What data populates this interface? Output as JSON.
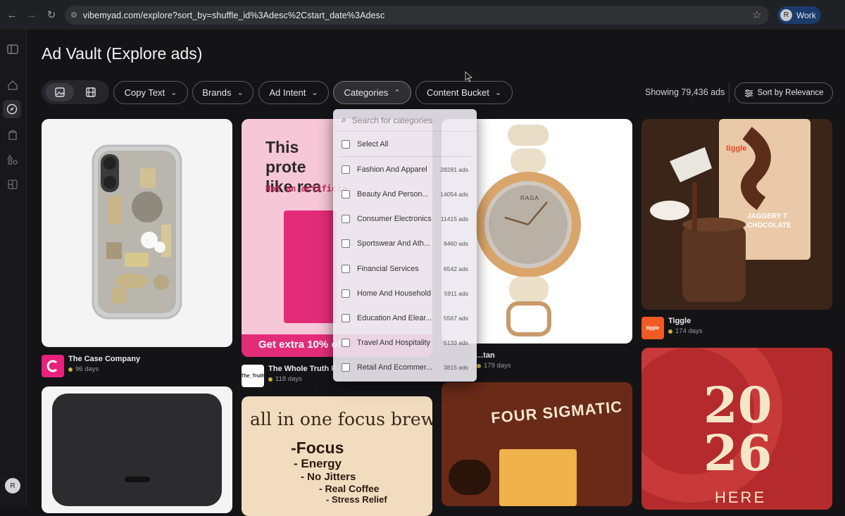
{
  "browser": {
    "url": "vibemyad.com/explore?sort_by=shuffle_id%3Adesc%2Cstart_date%3Adesc",
    "profile_initial": "R",
    "profile_label": "Work"
  },
  "sidebar": {
    "avatar_initial": "R"
  },
  "page": {
    "title": "Ad Vault (Explore ads)"
  },
  "filters": {
    "copy_text": "Copy Text",
    "brands": "Brands",
    "ad_intent": "Ad Intent",
    "categories": "Categories",
    "content_bucket": "Content Bucket"
  },
  "results": {
    "showing": "Showing 79,436 ads",
    "sort_label": "Sort by Relevance"
  },
  "categories_dropdown": {
    "search_placeholder": "Search for categories",
    "select_all": "Select All",
    "items": [
      {
        "label": "Fashion And Apparel",
        "count": "28281 ads"
      },
      {
        "label": "Beauty And Person...",
        "count": "14054 ads"
      },
      {
        "label": "Consumer Electronics",
        "count": "11415 ads"
      },
      {
        "label": "Sportswear And Ath...",
        "count": "8460 ads"
      },
      {
        "label": "Financial Services",
        "count": "6542 ads"
      },
      {
        "label": "Home And Household",
        "count": "5911 ads"
      },
      {
        "label": "Education And Elear...",
        "count": "5567 ads"
      },
      {
        "label": "Travel And Hospitality",
        "count": "5133 ads"
      },
      {
        "label": "Retail And Ecommer...",
        "count": "3815 ads"
      }
    ]
  },
  "ads": [
    {
      "brand": "The Case Company",
      "days": "96 days"
    },
    {
      "brand": "The Whole Truth F",
      "days": "118 days",
      "headline": "This prote like rea",
      "sub": "Not an artificia",
      "offer": "Get extra 10% off",
      "logo_text": "The_Truth"
    },
    {
      "brand": "...tan",
      "days": "179 days",
      "watch_brand": "RAGA"
    },
    {
      "brand": "Tiggle",
      "days": "174 days",
      "pack_text": "JAGGERY T CHOCOLATE",
      "pack_brand": "tiggle"
    },
    {
      "headline": "all in one focus brew",
      "lines": [
        "-Focus",
        "- Energy",
        "- No Jitters",
        "- Real Coffee",
        "- Stress Relief"
      ]
    },
    {
      "brand_text": "FOUR SIGMATIC"
    },
    {
      "year_top": "20",
      "year_bottom": "26",
      "word": "HERE"
    }
  ],
  "colors": {
    "accent_pink": "#e8217c",
    "tiggle_orange": "#f05a23"
  }
}
